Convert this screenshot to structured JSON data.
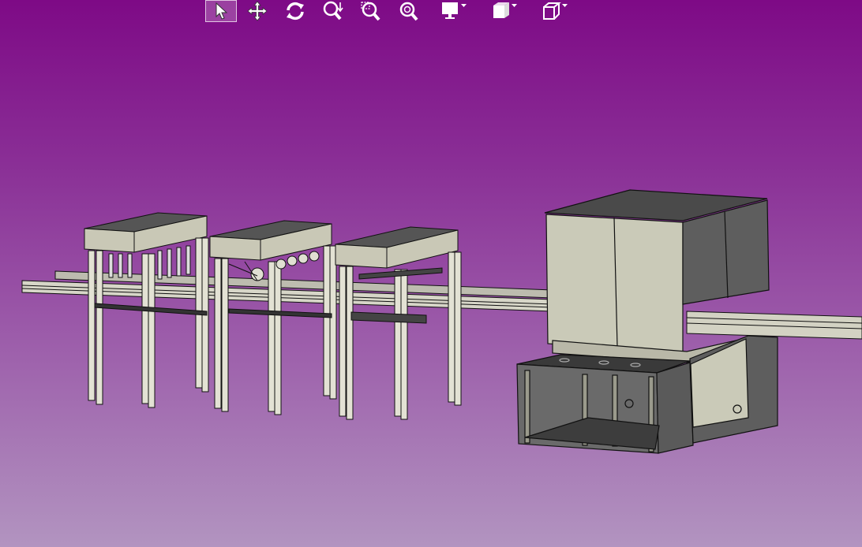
{
  "viewer": {
    "background_top": "#7e0a86",
    "background_bottom": "#b294c0"
  },
  "toolbar": {
    "buttons": [
      {
        "name": "select-tool-button",
        "icon": "cursor-arrow-icon",
        "active": true
      },
      {
        "name": "pan-tool-button",
        "icon": "move-arrows-icon",
        "active": false
      },
      {
        "name": "rotate-tool-button",
        "icon": "rotate-icon",
        "active": false
      },
      {
        "name": "zoom-dynamic-button",
        "icon": "zoom-dynamic-icon",
        "active": false
      },
      {
        "name": "zoom-window-button",
        "icon": "zoom-window-icon",
        "active": false
      },
      {
        "name": "zoom-fit-button",
        "icon": "zoom-fit-icon",
        "active": false
      },
      {
        "name": "display-mode-button",
        "icon": "monitor-icon",
        "has_dropdown": true
      },
      {
        "name": "material-button",
        "icon": "material-icon",
        "has_dropdown": true
      },
      {
        "name": "view-cube-button",
        "icon": "cube-view-icon",
        "has_dropdown": true
      }
    ]
  },
  "model": {
    "stations": 3,
    "machine_colors": {
      "panel_light": "#cacab8",
      "panel_dark": "#5e5e5e",
      "top": "#4a4a4a",
      "edge": "#111111"
    }
  }
}
